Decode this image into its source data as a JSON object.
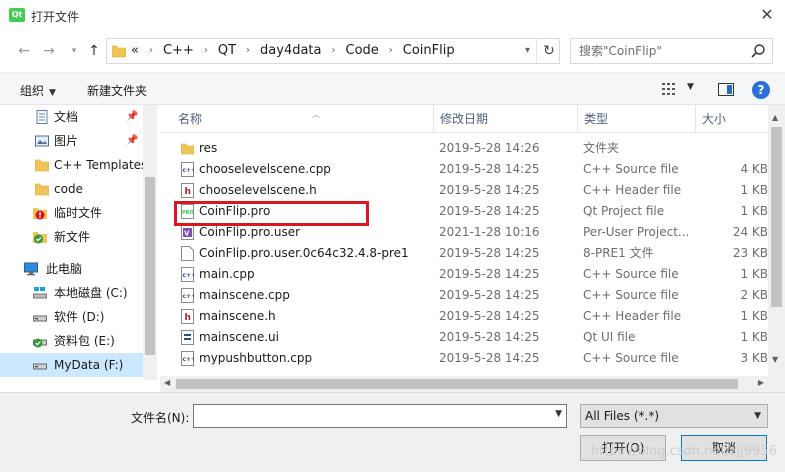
{
  "window": {
    "title": "打开文件",
    "app_icon_text": "Qt"
  },
  "nav": {
    "breadcrumbs": [
      "«",
      "C++",
      "QT",
      "day4data",
      "Code",
      "CoinFlip"
    ],
    "search_placeholder": "搜索\"CoinFlip\""
  },
  "toolbar": {
    "organize_label": "组织",
    "new_folder_label": "新建文件夹"
  },
  "sidebar": {
    "items": [
      {
        "label": "文档",
        "icon": "document-icon",
        "pinned": true
      },
      {
        "label": "图片",
        "icon": "picture-icon",
        "pinned": true
      },
      {
        "label": "C++ Templates",
        "icon": "folder-icon",
        "pinned": false
      },
      {
        "label": "code",
        "icon": "folder-icon",
        "pinned": false
      },
      {
        "label": "临时文件",
        "icon": "temp-folder-icon",
        "pinned": false
      },
      {
        "label": "新文件",
        "icon": "synced-folder-icon",
        "pinned": false
      },
      {
        "label": "此电脑",
        "icon": "computer-icon",
        "pinned": false
      },
      {
        "label": "本地磁盘 (C:)",
        "icon": "drive-c-icon",
        "pinned": false
      },
      {
        "label": "软件 (D:)",
        "icon": "drive-icon",
        "pinned": false
      },
      {
        "label": "资料包 (E:)",
        "icon": "drive-synced-icon",
        "pinned": false
      },
      {
        "label": "MyData (F:)",
        "icon": "drive-icon",
        "pinned": false,
        "selected": true
      }
    ]
  },
  "columns": {
    "name": "名称",
    "date": "修改日期",
    "type": "类型",
    "size": "大小"
  },
  "files": [
    {
      "name": "res",
      "date": "2019-5-28 14:26",
      "type": "文件夹",
      "size": "",
      "icon": "folder-icon"
    },
    {
      "name": "chooselevelscene.cpp",
      "date": "2019-5-28 14:25",
      "type": "C++ Source file",
      "size": "4 KB",
      "icon": "cpp-source-icon"
    },
    {
      "name": "chooselevelscene.h",
      "date": "2019-5-28 14:25",
      "type": "C++ Header file",
      "size": "1 KB",
      "icon": "cpp-header-icon"
    },
    {
      "name": "CoinFlip.pro",
      "date": "2019-5-28 14:25",
      "type": "Qt Project file",
      "size": "1 KB",
      "icon": "qt-project-icon"
    },
    {
      "name": "CoinFlip.pro.user",
      "date": "2021-1-28 10:16",
      "type": "Per-User Project...",
      "size": "24 KB",
      "icon": "user-project-icon"
    },
    {
      "name": "CoinFlip.pro.user.0c64c32.4.8-pre1",
      "date": "2019-5-28 14:25",
      "type": "8-PRE1 文件",
      "size": "23 KB",
      "icon": "blank-file-icon"
    },
    {
      "name": "main.cpp",
      "date": "2019-5-28 14:25",
      "type": "C++ Source file",
      "size": "1 KB",
      "icon": "cpp-source-icon"
    },
    {
      "name": "mainscene.cpp",
      "date": "2019-5-28 14:25",
      "type": "C++ Source file",
      "size": "2 KB",
      "icon": "cpp-source-icon"
    },
    {
      "name": "mainscene.h",
      "date": "2019-5-28 14:25",
      "type": "C++ Header file",
      "size": "1 KB",
      "icon": "cpp-header-icon"
    },
    {
      "name": "mainscene.ui",
      "date": "2019-5-28 14:25",
      "type": "Qt UI file",
      "size": "1 KB",
      "icon": "qt-ui-icon"
    },
    {
      "name": "mypushbutton.cpp",
      "date": "2019-5-28 14:25",
      "type": "C++ Source file",
      "size": "3 KB",
      "icon": "cpp-source-icon"
    }
  ],
  "bottom": {
    "filename_label": "文件名(N):",
    "filename_value": "",
    "filetype_value": "All Files (*.*)",
    "open_label": "打开(O)",
    "cancel_label": "取消",
    "watermark": "https://blog.csdn.net/zjj9956"
  },
  "colors": {
    "highlight_box": "#d9171d",
    "selected_bg": "#cce8ff",
    "accent": "#0078d7"
  }
}
